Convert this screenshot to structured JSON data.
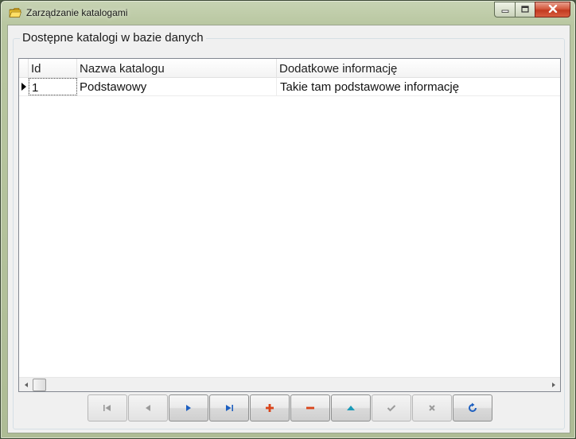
{
  "window": {
    "title": "Zarządzanie katalogami",
    "icon": "folder-icon"
  },
  "group": {
    "title": "Dostępne katalogi w bazie danych"
  },
  "grid": {
    "columns": [
      "Id",
      "Nazwa katalogu",
      "Dodatkowe informację"
    ],
    "rows": [
      [
        "1",
        "Podstawowy",
        "Takie tam podstawowe informację"
      ]
    ],
    "current_row": 0
  },
  "navigator": {
    "buttons": [
      {
        "name": "first-record",
        "icon": "first-icon",
        "enabled": false
      },
      {
        "name": "prior-record",
        "icon": "prior-icon",
        "enabled": false
      },
      {
        "name": "next-record",
        "icon": "next-icon",
        "enabled": true
      },
      {
        "name": "last-record",
        "icon": "last-icon",
        "enabled": true
      },
      {
        "name": "insert-record",
        "icon": "plus-icon",
        "enabled": true
      },
      {
        "name": "delete-record",
        "icon": "minus-icon",
        "enabled": true
      },
      {
        "name": "edit-record",
        "icon": "edit-up-icon",
        "enabled": true
      },
      {
        "name": "post-record",
        "icon": "check-icon",
        "enabled": false
      },
      {
        "name": "cancel-record",
        "icon": "cancel-icon",
        "enabled": false
      },
      {
        "name": "refresh-record",
        "icon": "refresh-icon",
        "enabled": true
      }
    ]
  },
  "colors": {
    "nav_blue": "#1d5fc0",
    "nav_red": "#d9441a",
    "nav_teal": "#1b9ab8",
    "nav_disabled": "#9a9a9a"
  }
}
